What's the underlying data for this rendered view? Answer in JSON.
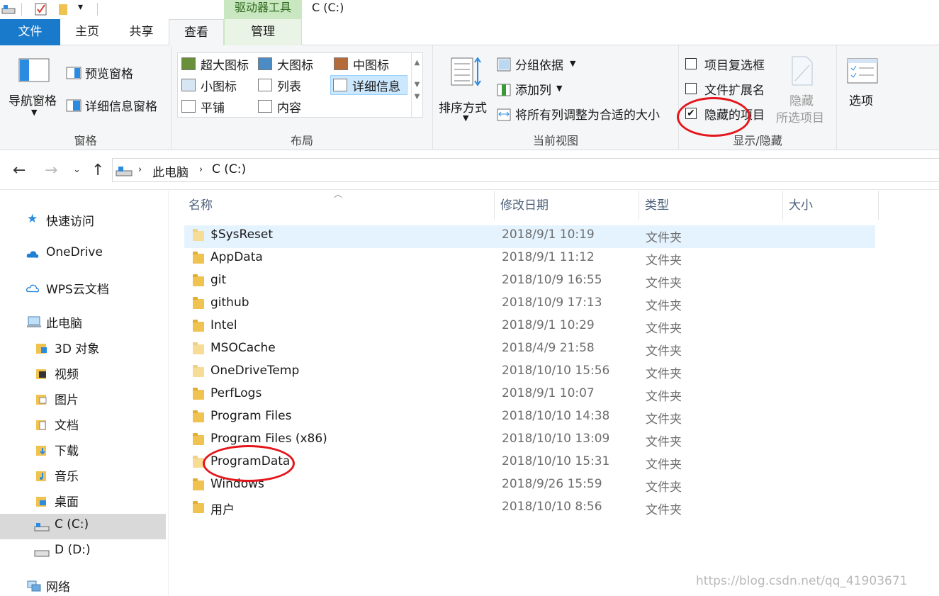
{
  "window": {
    "title": "C (C:)",
    "context_tab": "驱动器工具"
  },
  "tabs": {
    "file": "文件",
    "home": "主页",
    "share": "共享",
    "view": "查看",
    "manage": "管理"
  },
  "ribbon": {
    "panes": {
      "label": "窗格",
      "nav_pane": "导航窗格",
      "preview_pane": "预览窗格",
      "details_pane": "详细信息窗格"
    },
    "layout": {
      "label": "布局",
      "extra_large_icons": "超大图标",
      "large_icons": "大图标",
      "medium_icons": "中图标",
      "small_icons": "小图标",
      "list": "列表",
      "details": "详细信息",
      "tiles": "平铺",
      "content": "内容"
    },
    "current_view": {
      "label": "当前视图",
      "sort_by": "排序方式",
      "group_by": "分组依据",
      "add_columns": "添加列",
      "size_all_columns": "将所有列调整为合适的大小"
    },
    "show_hide": {
      "label": "显示/隐藏",
      "item_checkboxes": "项目复选框",
      "item_checkboxes_checked": false,
      "file_extensions": "文件扩展名",
      "file_extensions_checked": false,
      "hidden_items": "隐藏的项目",
      "hidden_items_checked": true,
      "hide_selected_line1": "隐藏",
      "hide_selected_line2": "所选项目"
    },
    "options": "选项"
  },
  "address": {
    "crumb1": "此电脑",
    "crumb2": "C (C:)"
  },
  "sidebar": {
    "quick_access": "快速访问",
    "onedrive": "OneDrive",
    "wps": "WPS云文档",
    "this_pc": "此电脑",
    "objects3d": "3D 对象",
    "videos": "视频",
    "pictures": "图片",
    "documents": "文档",
    "downloads": "下载",
    "music": "音乐",
    "desktop": "桌面",
    "drive_c": "C (C:)",
    "drive_d": "D (D:)",
    "network": "网络"
  },
  "columns": {
    "name": "名称",
    "date": "修改日期",
    "type": "类型",
    "size": "大小"
  },
  "files": [
    {
      "name": "$SysReset",
      "date": "2018/9/1 10:19",
      "type": "文件夹",
      "hidden": true
    },
    {
      "name": "AppData",
      "date": "2018/9/1 11:12",
      "type": "文件夹",
      "hidden": false
    },
    {
      "name": "git",
      "date": "2018/10/9 16:55",
      "type": "文件夹",
      "hidden": false
    },
    {
      "name": "github",
      "date": "2018/10/9 17:13",
      "type": "文件夹",
      "hidden": false
    },
    {
      "name": "Intel",
      "date": "2018/9/1 10:29",
      "type": "文件夹",
      "hidden": false
    },
    {
      "name": "MSOCache",
      "date": "2018/4/9 21:58",
      "type": "文件夹",
      "hidden": true
    },
    {
      "name": "OneDriveTemp",
      "date": "2018/10/10 15:56",
      "type": "文件夹",
      "hidden": true
    },
    {
      "name": "PerfLogs",
      "date": "2018/9/1 10:07",
      "type": "文件夹",
      "hidden": false
    },
    {
      "name": "Program Files",
      "date": "2018/10/10 14:38",
      "type": "文件夹",
      "hidden": false
    },
    {
      "name": "Program Files (x86)",
      "date": "2018/10/10 13:09",
      "type": "文件夹",
      "hidden": false
    },
    {
      "name": "ProgramData",
      "date": "2018/10/10 15:31",
      "type": "文件夹",
      "hidden": true
    },
    {
      "name": "Windows",
      "date": "2018/9/26 15:59",
      "type": "文件夹",
      "hidden": false
    },
    {
      "name": "用户",
      "date": "2018/10/10 8:56",
      "type": "文件夹",
      "hidden": false
    }
  ],
  "watermark": "https://blog.csdn.net/qq_41903671",
  "colors": {
    "file_tab": "#1979ca",
    "context_tab": "#c9e7c0",
    "selection": "#e5f3ff",
    "annotation": "#e4161c"
  }
}
